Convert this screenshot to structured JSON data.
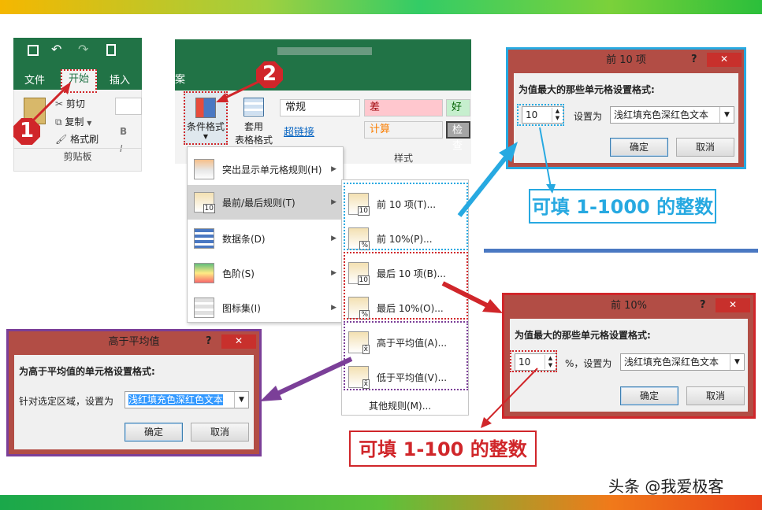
{
  "ribbon_left": {
    "tabs": [
      "文件",
      "开始",
      "插入"
    ],
    "active_tab": "开始",
    "clipboard": {
      "cut": "剪切",
      "copy": "复制",
      "format_painter": "格式刷",
      "group_label": "剪贴板"
    },
    "font_buttons": [
      "B",
      "I"
    ]
  },
  "ribbon_right": {
    "tab_fragment": "案",
    "conditional_format": "条件格式",
    "table_format_line1": "套用",
    "table_format_line2": "表格格式",
    "styles": {
      "normal": "常规",
      "bad": "差",
      "good": "好",
      "hyperlink": "超链接",
      "calc": "计算",
      "check": "检查",
      "group_label": "样式"
    }
  },
  "menu": {
    "items": [
      {
        "label": "突出显示单元格规则(H)"
      },
      {
        "label": "最前/最后规则(T)"
      },
      {
        "label": "数据条(D)"
      },
      {
        "label": "色阶(S)"
      },
      {
        "label": "图标集(I)"
      }
    ]
  },
  "submenu": {
    "items": [
      {
        "label": "前 10 项(T)...",
        "badge": "10"
      },
      {
        "label": "前 10%(P)...",
        "badge": "%"
      },
      {
        "label": "最后 10 项(B)...",
        "badge": "10"
      },
      {
        "label": "最后 10%(O)...",
        "badge": "%"
      },
      {
        "label": "高于平均值(A)...",
        "badge": "x̄"
      },
      {
        "label": "低于平均值(V)...",
        "badge": "x̄"
      }
    ],
    "more": "其他规则(M)..."
  },
  "dialog_top10": {
    "title": "前 10 项",
    "help": "?",
    "close": "✕",
    "prompt": "为值最大的那些单元格设置格式:",
    "value": "10",
    "set_as": "设置为",
    "format": "浅红填充色深红色文本",
    "ok": "确定",
    "cancel": "取消"
  },
  "dialog_top10pct": {
    "title": "前 10%",
    "help": "?",
    "close": "✕",
    "prompt": "为值最大的那些单元格设置格式:",
    "value": "10",
    "set_as": "%，设置为",
    "format": "浅红填充色深红色文本",
    "ok": "确定",
    "cancel": "取消"
  },
  "dialog_above_avg": {
    "title": "高于平均值",
    "help": "?",
    "close": "✕",
    "prompt": "为高于平均值的单元格设置格式:",
    "set_as": "针对选定区域，设置为",
    "format": "浅红填充色深红色文本",
    "ok": "确定",
    "cancel": "取消"
  },
  "callouts": {
    "blue": "可填 1-1000 的整数",
    "red": "可填 1-100 的整数",
    "step1": "1",
    "step2": "2"
  },
  "watermark": "头条 @我爱极客",
  "colors": {
    "excel_green": "#217346",
    "dialog_red": "#b24d45",
    "red": "#d0262a",
    "blue": "#27a9e1",
    "purple": "#7b3f98"
  }
}
